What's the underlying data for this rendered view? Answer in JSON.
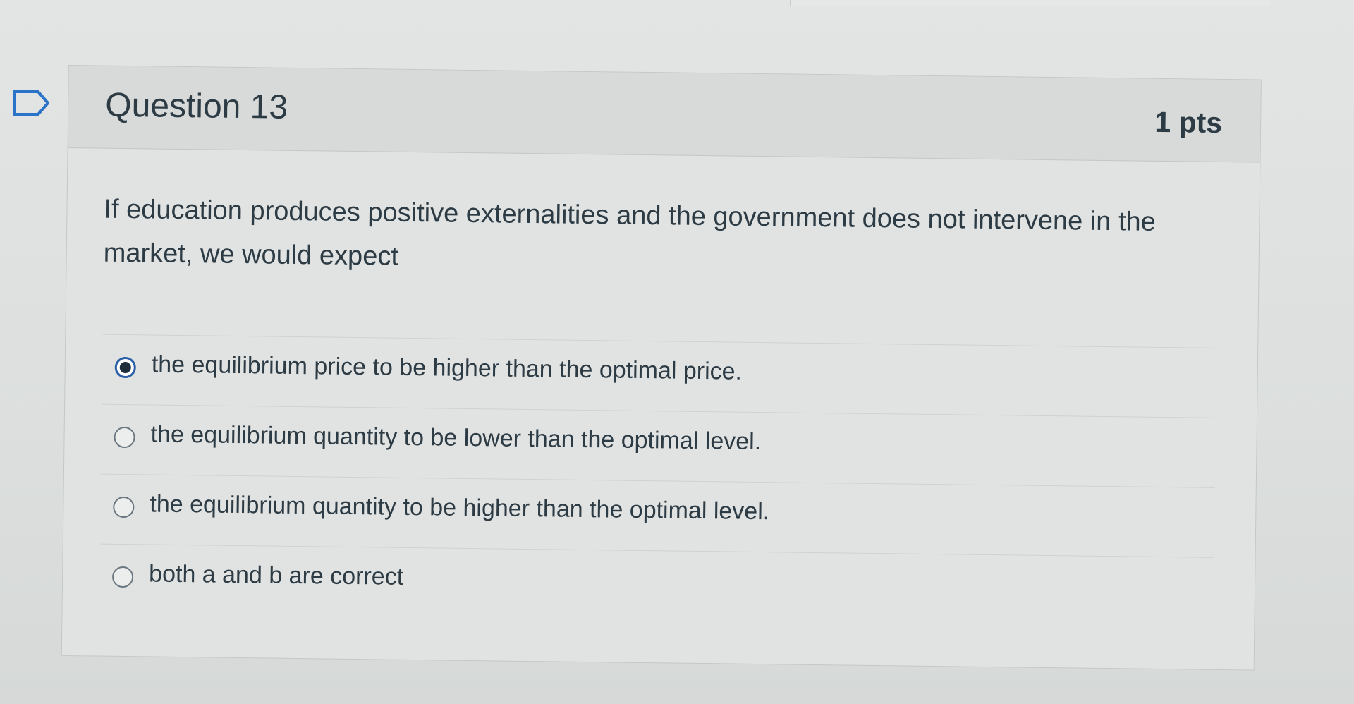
{
  "question": {
    "title": "Question 13",
    "points": "1 pts",
    "text": "If education produces positive externalities and the government does not intervene in the market, we would expect",
    "answers": [
      {
        "label": "the equilibrium price to be higher than the optimal price.",
        "selected": true
      },
      {
        "label": "the equilibrium quantity to be lower than the optimal level.",
        "selected": false
      },
      {
        "label": "the equilibrium quantity to be higher than the optimal level.",
        "selected": false
      },
      {
        "label": "both a and b are correct",
        "selected": false
      }
    ]
  },
  "icons": {
    "flag": "flag-outline-icon"
  },
  "colors": {
    "selected_radio": "#2b5fa8",
    "text": "#2d3b45"
  }
}
